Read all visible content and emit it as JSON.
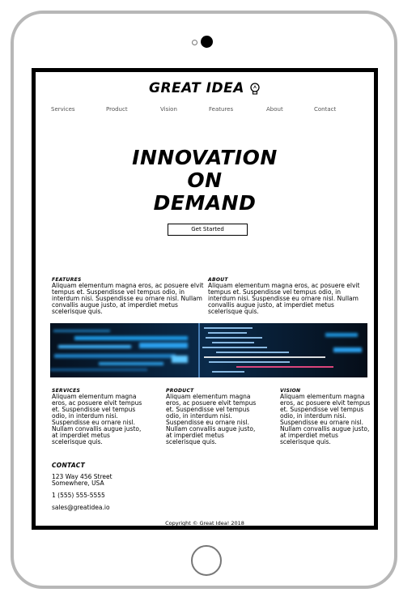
{
  "logo": {
    "text": "GREAT IDEA"
  },
  "nav": {
    "items": [
      "Services",
      "Product",
      "Vision",
      "Features",
      "About",
      "Contact"
    ]
  },
  "hero": {
    "lines": [
      "INNOVATION",
      "ON",
      "DEMAND"
    ],
    "cta": "Get Started"
  },
  "features": {
    "title": "FEATURES",
    "body": "Aliquam elementum magna eros, ac posuere elvit tempus et. Suspendisse vel tempus odio, in interdum nisi. Suspendisse eu ornare nisl. Nullam convallis augue justo, at imperdiet metus scelerisque quis."
  },
  "about": {
    "title": "ABOUT",
    "body": "Aliquam elementum magna eros, ac posuere elvit tempus et. Suspendisse vel tempus odio, in interdum nisi. Suspendisse eu ornare nisl. Nullam convallis augue justo, at imperdiet metus scelerisque quis."
  },
  "services": {
    "title": "SERVICES",
    "body": "Aliquam elementum magna eros, ac posuere elvit tempus et. Suspendisse vel tempus odio, in interdum nisi. Suspendisse eu ornare nisl. Nullam convallis augue justo, at imperdiet metus scelerisque quis."
  },
  "product": {
    "title": "PRODUCT",
    "body": "Aliquam elementum magna eros, ac posuere elvit tempus et. Suspendisse vel tempus odio, in interdum nisi. Suspendisse eu ornare nisl. Nullam convallis augue justo, at imperdiet metus scelerisque quis."
  },
  "vision": {
    "title": "VISION",
    "body": "Aliquam elementum magna eros, ac posuere elvit tempus et. Suspendisse vel tempus odio, in interdum nisi. Suspendisse eu ornare nisl. Nullam convallis augue justo, at imperdiet metus scelerisque quis."
  },
  "contact": {
    "title": "CONTACT",
    "address_line1": "123 Way 456 Street",
    "address_line2": "Somewhere, USA",
    "phone": "1 (555) 555-5555",
    "email": "sales@greatidea.io"
  },
  "footer": {
    "text": "Copyright © Great Idea! 2018"
  },
  "colors": {
    "frame": "#b7b7b7",
    "screen_border": "#000000",
    "banner_blue": "#1e8fd6"
  }
}
